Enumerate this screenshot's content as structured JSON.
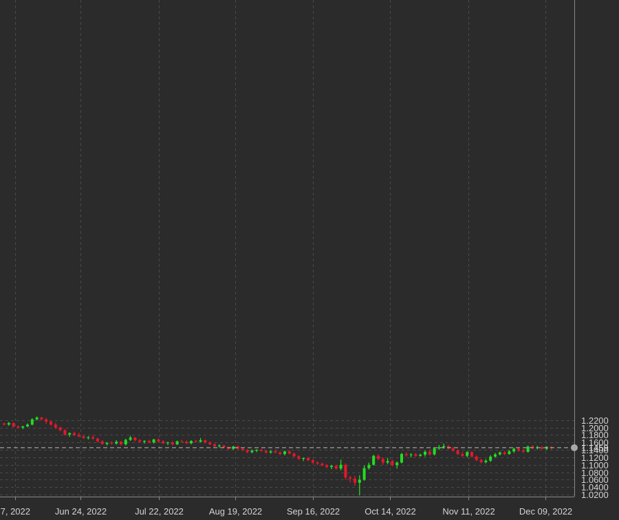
{
  "chart_data": {
    "type": "candlestick",
    "x_ticks": [
      "7, 2022",
      "Jun 24, 2022",
      "Jul 22, 2022",
      "Aug 19, 2022",
      "Sep 16, 2022",
      "Oct 14, 2022",
      "Nov 11, 2022",
      "Dec 09, 2022"
    ],
    "y_ticks": [
      "1.0200",
      "1.0400",
      "1.0600",
      "1.0800",
      "1.1000",
      "1.1200",
      "1.1400",
      "1.1600",
      "1.1800",
      "1.2000",
      "1.2200"
    ],
    "ylim": [
      1.008,
      1.235
    ],
    "last_price": 1.1459,
    "last_price_label": "1.1459",
    "grid": true,
    "colors": {
      "background": "#2b2b2b",
      "grid": "#4a4a4a",
      "up": "#22dd22",
      "down": "#e8152b",
      "axis_text": "#d4d4d4",
      "price_line": "#bdbdbd"
    },
    "candles": [
      [
        1.211,
        1.213,
        1.206,
        1.208
      ],
      [
        1.208,
        1.215,
        1.205,
        1.212
      ],
      [
        1.212,
        1.214,
        1.2,
        1.203
      ],
      [
        1.203,
        1.206,
        1.198,
        1.2
      ],
      [
        1.2,
        1.205,
        1.196,
        1.203
      ],
      [
        1.203,
        1.211,
        1.201,
        1.208
      ],
      [
        1.208,
        1.225,
        1.206,
        1.222
      ],
      [
        1.222,
        1.23,
        1.219,
        1.227
      ],
      [
        1.227,
        1.228,
        1.22,
        1.222
      ],
      [
        1.222,
        1.226,
        1.21,
        1.216
      ],
      [
        1.216,
        1.218,
        1.205,
        1.208
      ],
      [
        1.208,
        1.213,
        1.196,
        1.2
      ],
      [
        1.2,
        1.203,
        1.19,
        1.193
      ],
      [
        1.193,
        1.196,
        1.178,
        1.181
      ],
      [
        1.181,
        1.187,
        1.175,
        1.185
      ],
      [
        1.185,
        1.189,
        1.177,
        1.18
      ],
      [
        1.18,
        1.186,
        1.174,
        1.176
      ],
      [
        1.176,
        1.179,
        1.17,
        1.172
      ],
      [
        1.172,
        1.177,
        1.168,
        1.174
      ],
      [
        1.174,
        1.18,
        1.168,
        1.17
      ],
      [
        1.17,
        1.173,
        1.16,
        1.163
      ],
      [
        1.163,
        1.166,
        1.154,
        1.156
      ],
      [
        1.156,
        1.161,
        1.152,
        1.159
      ],
      [
        1.159,
        1.163,
        1.154,
        1.157
      ],
      [
        1.157,
        1.166,
        1.154,
        1.162
      ],
      [
        1.162,
        1.164,
        1.152,
        1.155
      ],
      [
        1.155,
        1.17,
        1.152,
        1.167
      ],
      [
        1.167,
        1.178,
        1.164,
        1.173
      ],
      [
        1.173,
        1.175,
        1.163,
        1.166
      ],
      [
        1.166,
        1.169,
        1.16,
        1.162
      ],
      [
        1.162,
        1.166,
        1.157,
        1.164
      ],
      [
        1.164,
        1.167,
        1.158,
        1.16
      ],
      [
        1.16,
        1.17,
        1.157,
        1.168
      ],
      [
        1.168,
        1.171,
        1.16,
        1.163
      ],
      [
        1.163,
        1.166,
        1.156,
        1.158
      ],
      [
        1.158,
        1.162,
        1.153,
        1.16
      ],
      [
        1.16,
        1.163,
        1.152,
        1.155
      ],
      [
        1.155,
        1.165,
        1.153,
        1.163
      ],
      [
        1.163,
        1.167,
        1.16,
        1.162
      ],
      [
        1.162,
        1.165,
        1.156,
        1.158
      ],
      [
        1.158,
        1.166,
        1.155,
        1.164
      ],
      [
        1.164,
        1.167,
        1.16,
        1.162
      ],
      [
        1.162,
        1.172,
        1.16,
        1.166
      ],
      [
        1.166,
        1.168,
        1.158,
        1.16
      ],
      [
        1.16,
        1.163,
        1.153,
        1.155
      ],
      [
        1.155,
        1.158,
        1.147,
        1.15
      ],
      [
        1.15,
        1.155,
        1.146,
        1.152
      ],
      [
        1.152,
        1.154,
        1.145,
        1.147
      ],
      [
        1.147,
        1.15,
        1.14,
        1.143
      ],
      [
        1.143,
        1.151,
        1.14,
        1.149
      ],
      [
        1.149,
        1.152,
        1.141,
        1.143
      ],
      [
        1.143,
        1.145,
        1.137,
        1.139
      ],
      [
        1.139,
        1.142,
        1.131,
        1.134
      ],
      [
        1.134,
        1.141,
        1.131,
        1.138
      ],
      [
        1.138,
        1.142,
        1.134,
        1.14
      ],
      [
        1.14,
        1.143,
        1.135,
        1.137
      ],
      [
        1.137,
        1.14,
        1.13,
        1.133
      ],
      [
        1.133,
        1.139,
        1.13,
        1.136
      ],
      [
        1.136,
        1.14,
        1.131,
        1.133
      ],
      [
        1.133,
        1.136,
        1.126,
        1.129
      ],
      [
        1.129,
        1.138,
        1.125,
        1.136
      ],
      [
        1.136,
        1.139,
        1.128,
        1.13
      ],
      [
        1.13,
        1.133,
        1.12,
        1.123
      ],
      [
        1.123,
        1.126,
        1.113,
        1.116
      ],
      [
        1.116,
        1.12,
        1.11,
        1.118
      ],
      [
        1.118,
        1.121,
        1.11,
        1.112
      ],
      [
        1.112,
        1.115,
        1.104,
        1.106
      ],
      [
        1.106,
        1.11,
        1.099,
        1.103
      ],
      [
        1.103,
        1.106,
        1.096,
        1.099
      ],
      [
        1.099,
        1.102,
        1.091,
        1.094
      ],
      [
        1.094,
        1.1,
        1.088,
        1.097
      ],
      [
        1.097,
        1.1,
        1.087,
        1.09
      ],
      [
        1.09,
        1.114,
        1.085,
        1.1
      ],
      [
        1.1,
        1.104,
        1.06,
        1.066
      ],
      [
        1.066,
        1.07,
        1.053,
        1.063
      ],
      [
        1.063,
        1.07,
        1.043,
        1.052
      ],
      [
        1.052,
        1.072,
        1.018,
        1.06
      ],
      [
        1.06,
        1.098,
        1.057,
        1.091
      ],
      [
        1.091,
        1.106,
        1.087,
        1.1
      ],
      [
        1.1,
        1.127,
        1.098,
        1.124
      ],
      [
        1.124,
        1.128,
        1.112,
        1.116
      ],
      [
        1.116,
        1.12,
        1.1,
        1.106
      ],
      [
        1.106,
        1.118,
        1.102,
        1.11
      ],
      [
        1.11,
        1.114,
        1.096,
        1.099
      ],
      [
        1.099,
        1.109,
        1.09,
        1.106
      ],
      [
        1.106,
        1.132,
        1.104,
        1.129
      ],
      [
        1.129,
        1.134,
        1.122,
        1.126
      ],
      [
        1.126,
        1.131,
        1.12,
        1.128
      ],
      [
        1.128,
        1.132,
        1.121,
        1.124
      ],
      [
        1.124,
        1.13,
        1.122,
        1.127
      ],
      [
        1.127,
        1.138,
        1.122,
        1.135
      ],
      [
        1.135,
        1.141,
        1.125,
        1.128
      ],
      [
        1.128,
        1.146,
        1.125,
        1.144
      ],
      [
        1.144,
        1.153,
        1.14,
        1.147
      ],
      [
        1.147,
        1.157,
        1.143,
        1.15
      ],
      [
        1.15,
        1.153,
        1.141,
        1.144
      ],
      [
        1.144,
        1.148,
        1.135,
        1.138
      ],
      [
        1.138,
        1.141,
        1.126,
        1.129
      ],
      [
        1.129,
        1.135,
        1.121,
        1.124
      ],
      [
        1.124,
        1.137,
        1.12,
        1.134
      ],
      [
        1.134,
        1.137,
        1.12,
        1.122
      ],
      [
        1.122,
        1.125,
        1.11,
        1.113
      ],
      [
        1.113,
        1.116,
        1.104,
        1.107
      ],
      [
        1.107,
        1.115,
        1.104,
        1.111
      ],
      [
        1.111,
        1.126,
        1.108,
        1.122
      ],
      [
        1.122,
        1.132,
        1.119,
        1.128
      ],
      [
        1.128,
        1.136,
        1.125,
        1.133
      ],
      [
        1.133,
        1.137,
        1.126,
        1.129
      ],
      [
        1.129,
        1.14,
        1.127,
        1.136
      ],
      [
        1.136,
        1.146,
        1.132,
        1.143
      ],
      [
        1.143,
        1.147,
        1.135,
        1.138
      ],
      [
        1.138,
        1.142,
        1.132,
        1.135
      ],
      [
        1.135,
        1.152,
        1.133,
        1.149
      ],
      [
        1.149,
        1.153,
        1.142,
        1.146
      ],
      [
        1.146,
        1.151,
        1.141,
        1.147
      ],
      [
        1.147,
        1.151,
        1.141,
        1.143
      ],
      [
        1.143,
        1.15,
        1.14,
        1.148
      ],
      [
        1.148,
        1.15,
        1.141,
        1.1459
      ]
    ]
  }
}
